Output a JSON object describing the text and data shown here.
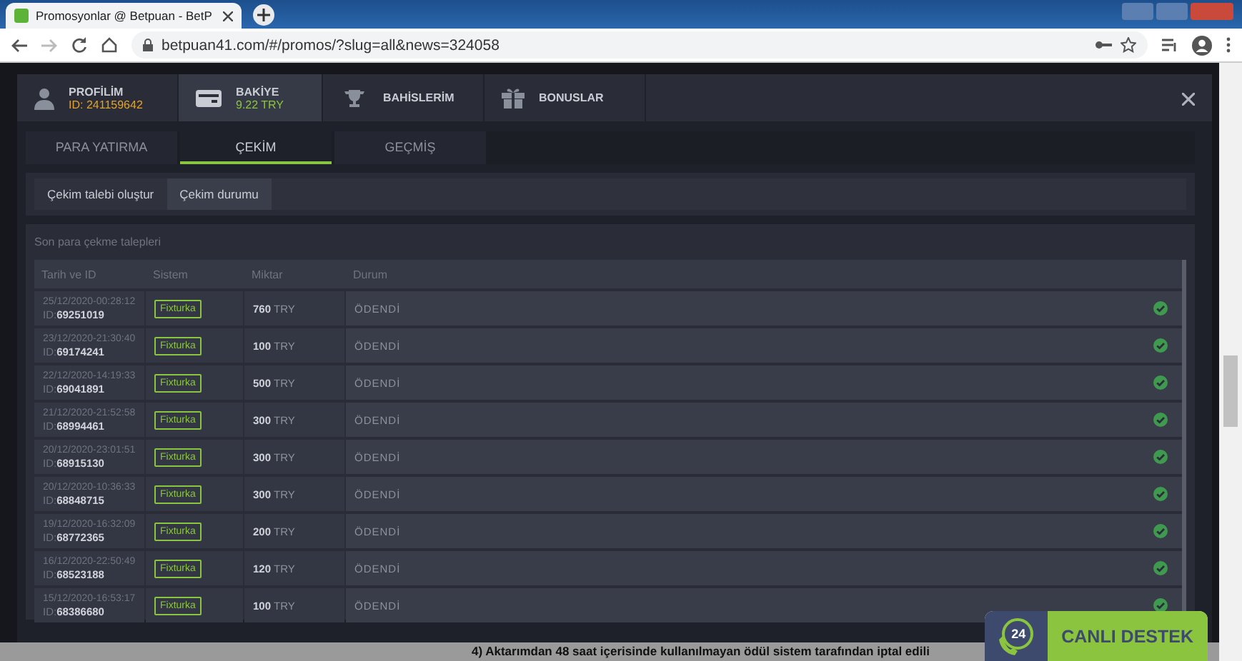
{
  "browser": {
    "tab_title": "Promosyonlar @ Betpuan - BetP",
    "url": "betpuan41.com/#/promos/?slug=all&news=324058"
  },
  "header": {
    "items": [
      {
        "kind": "profile",
        "title": "PROFİLİM",
        "sub": "ID: 241159642",
        "selected": false
      },
      {
        "kind": "balance",
        "title": "BAKİYE",
        "sub": "9.22 TRY",
        "selected": true
      },
      {
        "kind": "bets",
        "title": "BAHİSLERİM",
        "selected": false
      },
      {
        "kind": "bonus",
        "title": "BONUSLAR",
        "selected": false
      }
    ]
  },
  "tabs": [
    {
      "label": "PARA YATIRMA",
      "selected": false
    },
    {
      "label": "ÇEKİM",
      "selected": true
    },
    {
      "label": "GEÇMİŞ",
      "selected": false
    }
  ],
  "subtabs": [
    {
      "label": "Çekim talebi oluştur",
      "selected": false
    },
    {
      "label": "Çekim durumu",
      "selected": true
    }
  ],
  "table": {
    "title": "Son para çekme talepleri",
    "columns": [
      "Tarih ve ID",
      "Sistem",
      "Miktar",
      "Durum"
    ],
    "rows": [
      {
        "date": "25/12/2020-00:28:12",
        "id_label": "ID:",
        "id": "69251019",
        "system": "Fixturka",
        "amount": "760",
        "currency": "TRY",
        "status": "ÖDENDİ"
      },
      {
        "date": "23/12/2020-21:30:40",
        "id_label": "ID:",
        "id": "69174241",
        "system": "Fixturka",
        "amount": "100",
        "currency": "TRY",
        "status": "ÖDENDİ"
      },
      {
        "date": "22/12/2020-14:19:33",
        "id_label": "ID:",
        "id": "69041891",
        "system": "Fixturka",
        "amount": "500",
        "currency": "TRY",
        "status": "ÖDENDİ"
      },
      {
        "date": "21/12/2020-21:52:58",
        "id_label": "ID:",
        "id": "68994461",
        "system": "Fixturka",
        "amount": "300",
        "currency": "TRY",
        "status": "ÖDENDİ"
      },
      {
        "date": "20/12/2020-23:01:51",
        "id_label": "ID:",
        "id": "68915130",
        "system": "Fixturka",
        "amount": "300",
        "currency": "TRY",
        "status": "ÖDENDİ"
      },
      {
        "date": "20/12/2020-10:36:33",
        "id_label": "ID:",
        "id": "68848715",
        "system": "Fixturka",
        "amount": "300",
        "currency": "TRY",
        "status": "ÖDENDİ"
      },
      {
        "date": "19/12/2020-16:32:09",
        "id_label": "ID:",
        "id": "68772365",
        "system": "Fixturka",
        "amount": "200",
        "currency": "TRY",
        "status": "ÖDENDİ"
      },
      {
        "date": "16/12/2020-22:50:49",
        "id_label": "ID:",
        "id": "68523188",
        "system": "Fixturka",
        "amount": "120",
        "currency": "TRY",
        "status": "ÖDENDİ"
      },
      {
        "date": "15/12/2020-16:53:17",
        "id_label": "ID:",
        "id": "68386680",
        "system": "Fixturka",
        "amount": "100",
        "currency": "TRY",
        "status": "ÖDENDİ"
      }
    ]
  },
  "footer_text": "4) Aktarımdan 48 saat içerisinde kullanılmayan ödül sistem tarafından iptal edili",
  "support": {
    "badge": "24",
    "label": "CANLI DESTEK"
  }
}
